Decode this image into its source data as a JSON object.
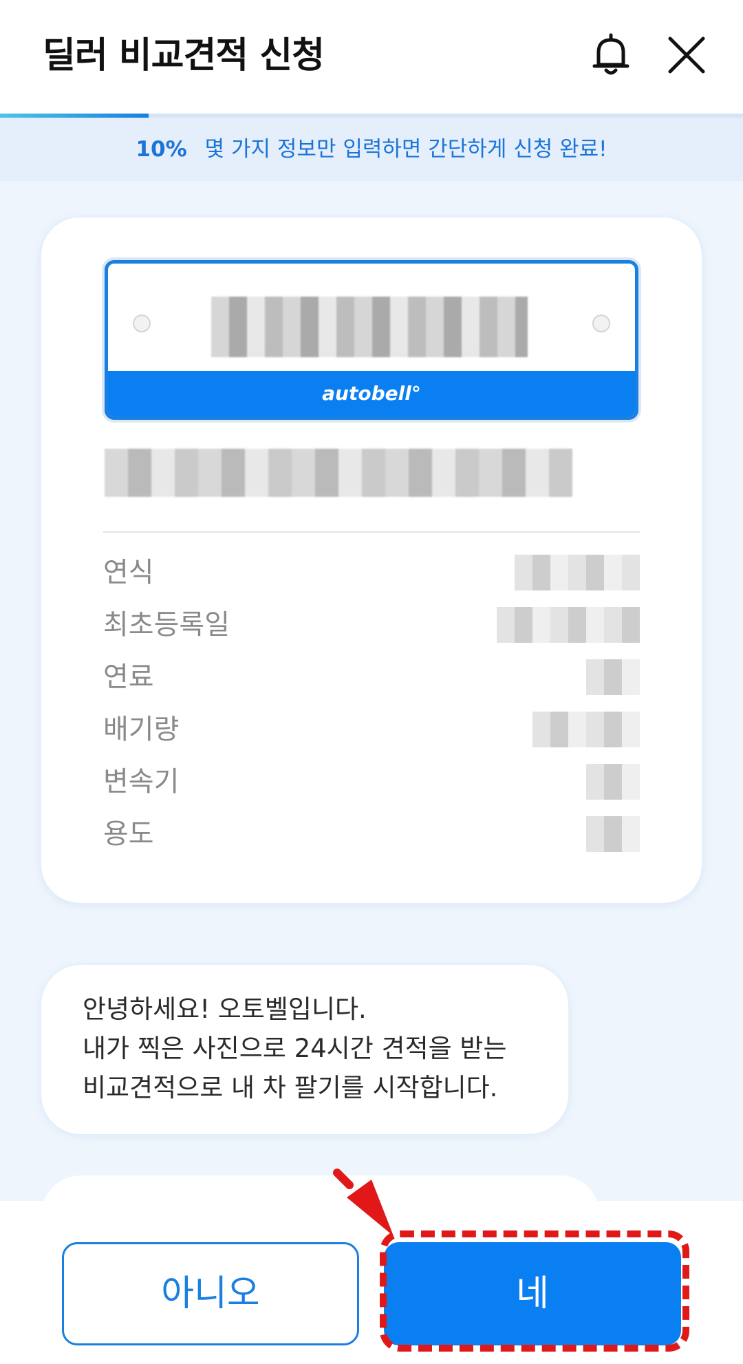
{
  "header": {
    "title": "딜러 비교견적 신청",
    "bell_icon": "bell-icon",
    "close_icon": "close-icon"
  },
  "progress": {
    "percent_label": "10%",
    "value": 0.2,
    "message": "몇 가지 정보만 입력하면 간단하게 신청 완료!"
  },
  "car_card": {
    "plate_brand": "autobell°",
    "specs": [
      {
        "label": "연식"
      },
      {
        "label": "최초등록일"
      },
      {
        "label": "연료"
      },
      {
        "label": "배기량"
      },
      {
        "label": "변속기"
      },
      {
        "label": "용도"
      }
    ]
  },
  "chat": {
    "lines": [
      "안녕하세요! 오토벨입니다.",
      "내가 찍은 사진으로 24시간 견적을 받는",
      "비교견적으로 내 차 팔기를 시작합니다."
    ]
  },
  "actions": {
    "no_label": "아니오",
    "yes_label": "네"
  },
  "colors": {
    "accent": "#0a7ff2",
    "highlight": "#e01818",
    "background": "#eef5fd"
  }
}
